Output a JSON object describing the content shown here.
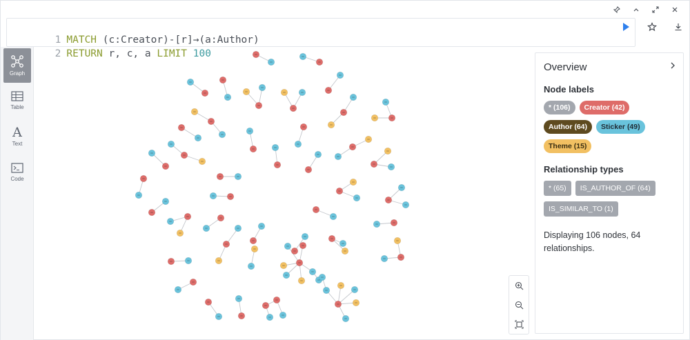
{
  "editor": {
    "lines": [
      {
        "no": "1",
        "kw1": "MATCH",
        "rest": " (c:Creator)-[r]→(a:Author)"
      },
      {
        "no": "2",
        "kw1": "RETURN",
        "rest": " r, c, a ",
        "kw2": "LIMIT",
        "num": " 100"
      }
    ]
  },
  "nav": {
    "items": [
      {
        "label": "Graph",
        "icon": "graph-icon"
      },
      {
        "label": "Table",
        "icon": "table-icon"
      },
      {
        "label": "Text",
        "icon": "text-icon"
      },
      {
        "label": "Code",
        "icon": "code-icon"
      }
    ]
  },
  "colors": {
    "creator": "#de6c69",
    "author": "#5e4a1f",
    "sticker": "#69c3dc",
    "theme": "#f2c062",
    "all": "#a3a7ae",
    "play": "#2f80ed"
  },
  "panel": {
    "title": "Overview",
    "node_labels_heading": "Node labels",
    "node_labels": [
      {
        "label": "* (106)"
      },
      {
        "label": "Creator (42)"
      },
      {
        "label": "Author (64)"
      },
      {
        "label": "Sticker (49)"
      },
      {
        "label": "Theme (15)"
      }
    ],
    "relationship_types_heading": "Relationship types",
    "relationship_types": [
      {
        "label": "* (65)"
      },
      {
        "label": "IS_AUTHOR_OF (64)"
      },
      {
        "label": "IS_SIMILAR_TO (1)"
      }
    ],
    "summary": "Displaying 106 nodes, 64 relationships."
  }
}
